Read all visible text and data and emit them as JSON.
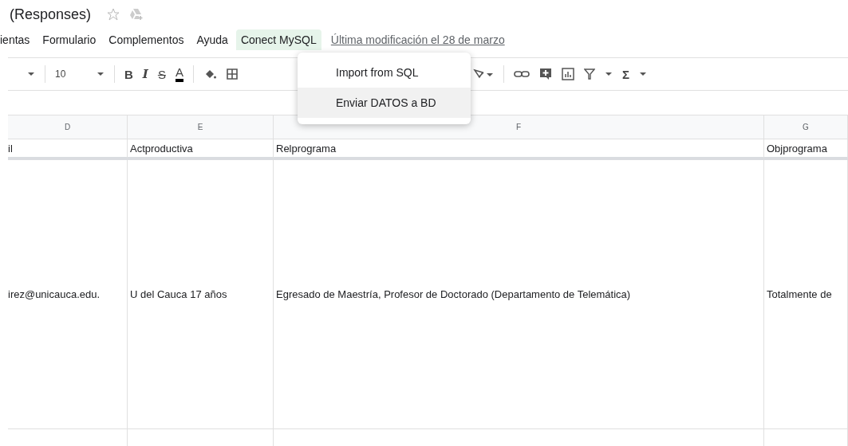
{
  "document": {
    "title": "(Responses)",
    "starred": false
  },
  "menu": [
    {
      "label": "ientas",
      "selected": false
    },
    {
      "label": "Formulario",
      "selected": false
    },
    {
      "label": "Complementos",
      "selected": false
    },
    {
      "label": "Ayuda",
      "selected": false
    },
    {
      "label": "Conect MySQL",
      "selected": true
    }
  ],
  "last_edit": "Última modificación el 28 de marzo",
  "toolbar": {
    "font_size": "10",
    "bold": "B",
    "italic": "I",
    "strike": "S",
    "text_color": "A",
    "sum": "Σ"
  },
  "dropdown": [
    {
      "label": "Import from SQL",
      "selected": false
    },
    {
      "label": "Enviar DATOS a BD",
      "selected": true
    }
  ],
  "columns": [
    "D",
    "E",
    "F",
    "G"
  ],
  "rows": [
    [
      "il",
      "Actproductiva",
      "Relprograma",
      "Objprograma"
    ],
    [
      "irez@unicauca.edu.",
      "U del Cauca 17 años",
      "Egresado de Maestría, Profesor de Doctorado (Departamento de Telemática)",
      "Totalmente de"
    ],
    [
      "",
      "",
      "",
      ""
    ]
  ]
}
